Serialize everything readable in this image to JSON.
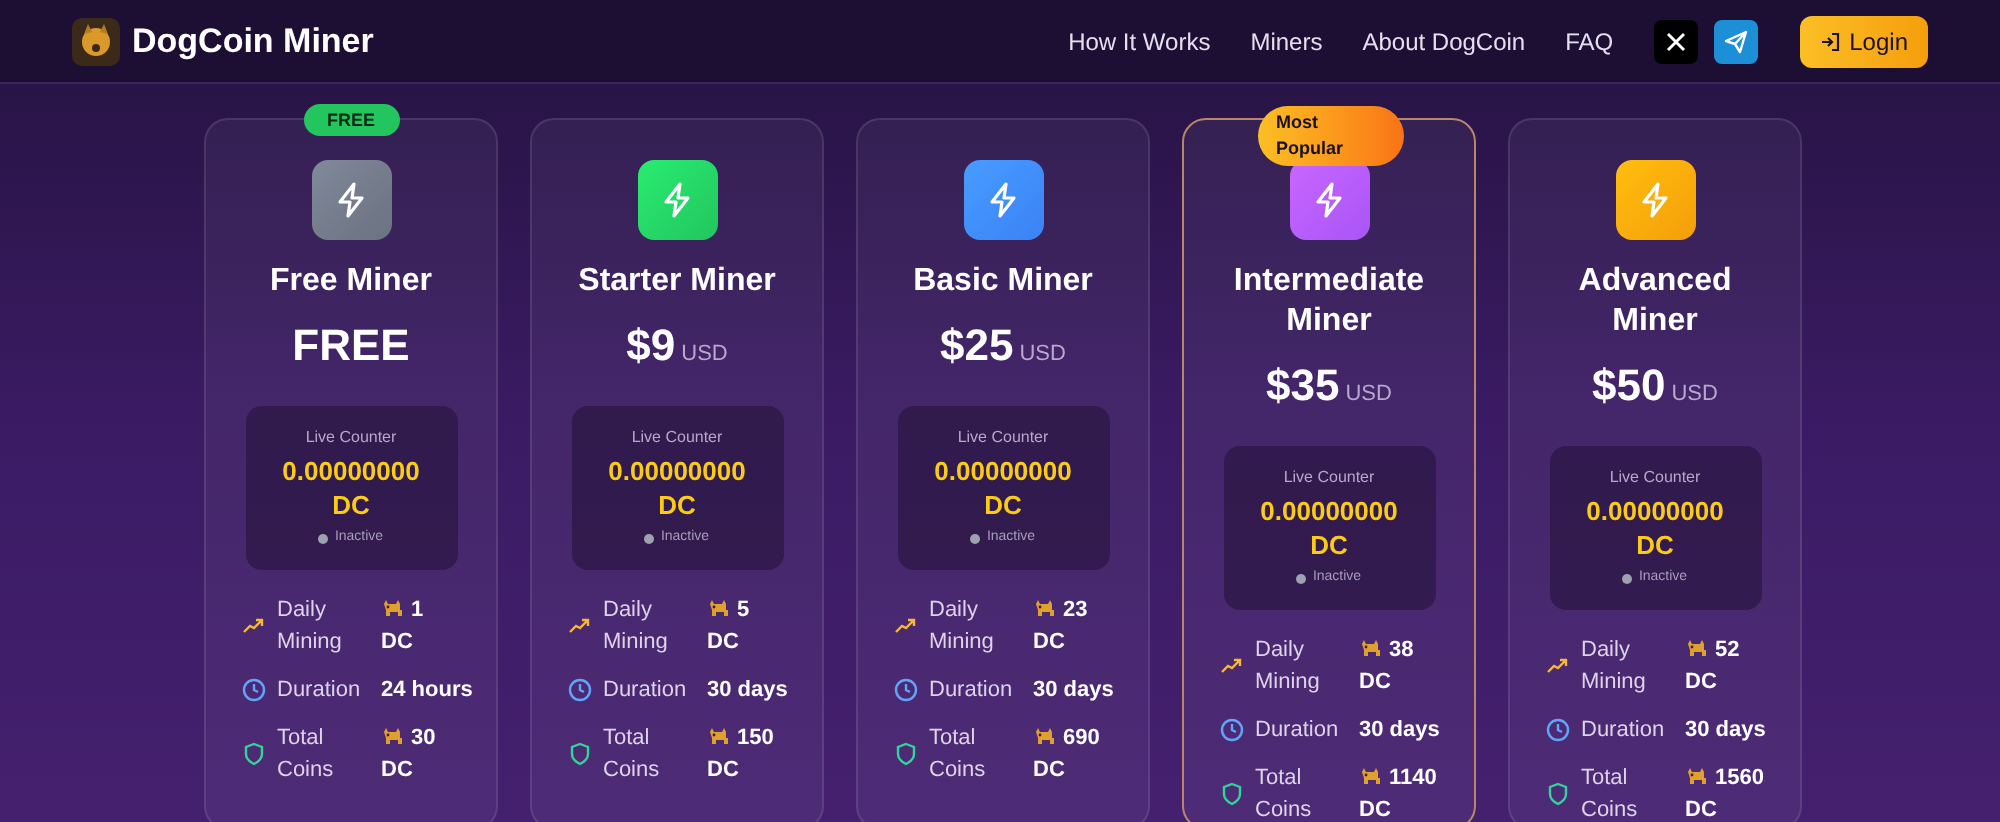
{
  "header": {
    "brand": "DogCoin Miner",
    "nav": [
      "How It Works",
      "Miners",
      "About DogCoin",
      "FAQ"
    ],
    "login": "Login"
  },
  "miners": [
    {
      "title": "Free Miner",
      "price": "FREE",
      "badge": {
        "kind": "free",
        "text": "FREE"
      },
      "color": "#6b7280",
      "featured": false,
      "counter": {
        "label": "Live Counter",
        "value": "0.00000000 DC",
        "status": "Inactive",
        "active": false
      },
      "stats": [
        {
          "kind": "daily",
          "label": "Daily Mining",
          "value": "1",
          "unit": "DC"
        },
        {
          "kind": "duration",
          "label": "Duration",
          "value": "24 hours"
        },
        {
          "kind": "total",
          "label": "Total Coins",
          "value": "30",
          "unit": "DC"
        }
      ]
    },
    {
      "title": "Starter Miner",
      "price": "$9",
      "currency": "USD",
      "color": "#22c55e",
      "featured": false,
      "counter": {
        "label": "Live Counter",
        "value": "0.00000000 DC",
        "status": "Inactive",
        "active": false
      },
      "stats": [
        {
          "kind": "daily",
          "label": "Daily Mining",
          "value": "5",
          "unit": "DC"
        },
        {
          "kind": "duration",
          "label": "Duration",
          "value": "30 days"
        },
        {
          "kind": "total",
          "label": "Total Coins",
          "value": "150",
          "unit": "DC"
        }
      ]
    },
    {
      "title": "Basic Miner",
      "price": "$25",
      "currency": "USD",
      "color": "#3b82f6",
      "featured": false,
      "counter": {
        "label": "Live Counter",
        "value": "0.00000000 DC",
        "status": "Inactive",
        "active": false
      },
      "stats": [
        {
          "kind": "daily",
          "label": "Daily Mining",
          "value": "23",
          "unit": "DC"
        },
        {
          "kind": "duration",
          "label": "Duration",
          "value": "30 days"
        },
        {
          "kind": "total",
          "label": "Total Coins",
          "value": "690",
          "unit": "DC"
        }
      ]
    },
    {
      "title": "Intermediate Miner",
      "price": "$35",
      "currency": "USD",
      "badge": {
        "kind": "popular",
        "text": "Most Popular"
      },
      "color": "#a855f7",
      "featured": true,
      "counter": {
        "label": "Live Counter",
        "value": "0.00000000 DC",
        "status": "Inactive",
        "active": false
      },
      "stats": [
        {
          "kind": "daily",
          "label": "Daily Mining",
          "value": "38",
          "unit": "DC"
        },
        {
          "kind": "duration",
          "label": "Duration",
          "value": "30 days"
        },
        {
          "kind": "total",
          "label": "Total Coins",
          "value": "1140",
          "unit": "DC"
        }
      ]
    },
    {
      "title": "Advanced Miner",
      "price": "$50",
      "currency": "USD",
      "color": "#f59e0b",
      "featured": false,
      "counter": {
        "label": "Live Counter",
        "value": "0.00000000 DC",
        "status": "Inactive",
        "active": false
      },
      "stats": [
        {
          "kind": "daily",
          "label": "Daily Mining",
          "value": "52",
          "unit": "DC"
        },
        {
          "kind": "duration",
          "label": "Duration",
          "value": "30 days"
        },
        {
          "kind": "total",
          "label": "Total Coins",
          "value": "1560",
          "unit": "DC"
        }
      ]
    }
  ]
}
